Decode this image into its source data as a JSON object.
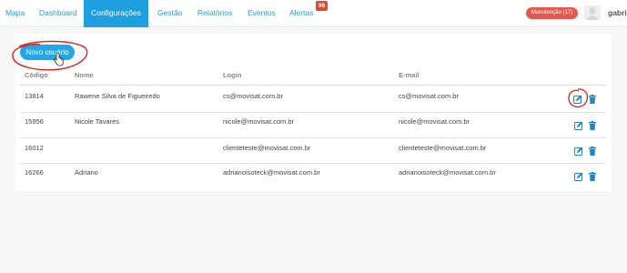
{
  "nav": {
    "items": [
      {
        "label": "Mapa",
        "active": false
      },
      {
        "label": "Dashboard",
        "active": false
      },
      {
        "label": "Configurações",
        "active": true
      },
      {
        "label": "Gestão",
        "active": false
      },
      {
        "label": "Relatórios",
        "active": false
      },
      {
        "label": "Eventos",
        "active": false
      },
      {
        "label": "Alertas",
        "active": false
      }
    ],
    "alerts_badge": "99",
    "maintenance_label": "Manutenção (17)",
    "username": "gabri"
  },
  "new_user_button": "Novo usuário",
  "table": {
    "headers": [
      "Código",
      "Nome",
      "Login",
      "E-mail"
    ],
    "rows": [
      {
        "code": "13814",
        "name": "Rawene Silva de Figueiredo",
        "login": "cs@movisat.com.br",
        "email": "cs@movisat.com.br"
      },
      {
        "code": "15956",
        "name": "Nicole Tavares",
        "login": "nicole@movisat.com.br",
        "email": "nicole@movisat.com.br"
      },
      {
        "code": "16012",
        "name": "",
        "login": "clienteteste@movisat.com.br",
        "email": "clienteteste@movisat.com.br"
      },
      {
        "code": "16266",
        "name": "Adriano",
        "login": "adrianoisoteck@movisat.com.br",
        "email": "adrianoisoteck@movisat.com.br"
      }
    ]
  },
  "icons": {
    "edit": "edit-icon",
    "delete": "trash-icon",
    "user": "user-avatar-icon",
    "cursor": "hand-cursor-icon"
  },
  "colors": {
    "accent": "#1f9fe0",
    "danger": "#e6574d",
    "annotation": "#e0201c"
  }
}
